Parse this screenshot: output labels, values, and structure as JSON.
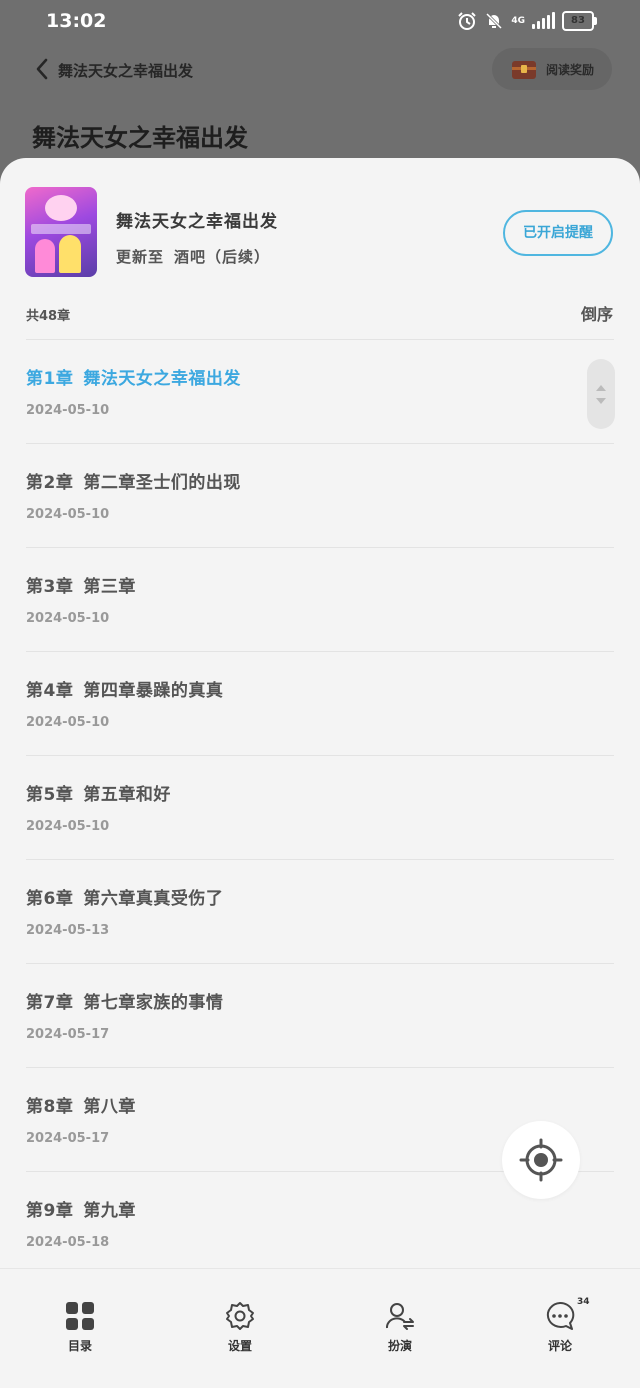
{
  "status_bar": {
    "time": "13:02",
    "network": "4G",
    "battery": "83"
  },
  "nav": {
    "title": "舞法天女之幸福出发",
    "reward_label": "阅读奖励"
  },
  "page": {
    "title": "舞法天女之幸福出发"
  },
  "book": {
    "name": "舞法天女之幸福出发",
    "update_prefix": "更新至",
    "update_chapter": "酒吧（后续）",
    "reminder_label": "已开启提醒"
  },
  "list": {
    "count_label": "共48章",
    "sort_label": "倒序"
  },
  "chapters": [
    {
      "num": "第1章",
      "name": "舞法天女之幸福出发",
      "date": "2024-05-10"
    },
    {
      "num": "第2章",
      "name": "第二章圣士们的出现",
      "date": "2024-05-10"
    },
    {
      "num": "第3章",
      "name": "第三章",
      "date": "2024-05-10"
    },
    {
      "num": "第4章",
      "name": "第四章暴躁的真真",
      "date": "2024-05-10"
    },
    {
      "num": "第5章",
      "name": "第五章和好",
      "date": "2024-05-10"
    },
    {
      "num": "第6章",
      "name": "第六章真真受伤了",
      "date": "2024-05-13"
    },
    {
      "num": "第7章",
      "name": "第七章家族的事情",
      "date": "2024-05-17"
    },
    {
      "num": "第8章",
      "name": "第八章",
      "date": "2024-05-17"
    },
    {
      "num": "第9章",
      "name": "第九章",
      "date": "2024-05-18"
    }
  ],
  "tabs": {
    "catalog": "目录",
    "settings": "设置",
    "roleplay": "扮演",
    "comments": "评论",
    "comments_badge": "34"
  },
  "colors": {
    "accent": "#3ca8e0",
    "sheet_bg": "#f4f4f4",
    "overlay": "#6f6f6f"
  }
}
